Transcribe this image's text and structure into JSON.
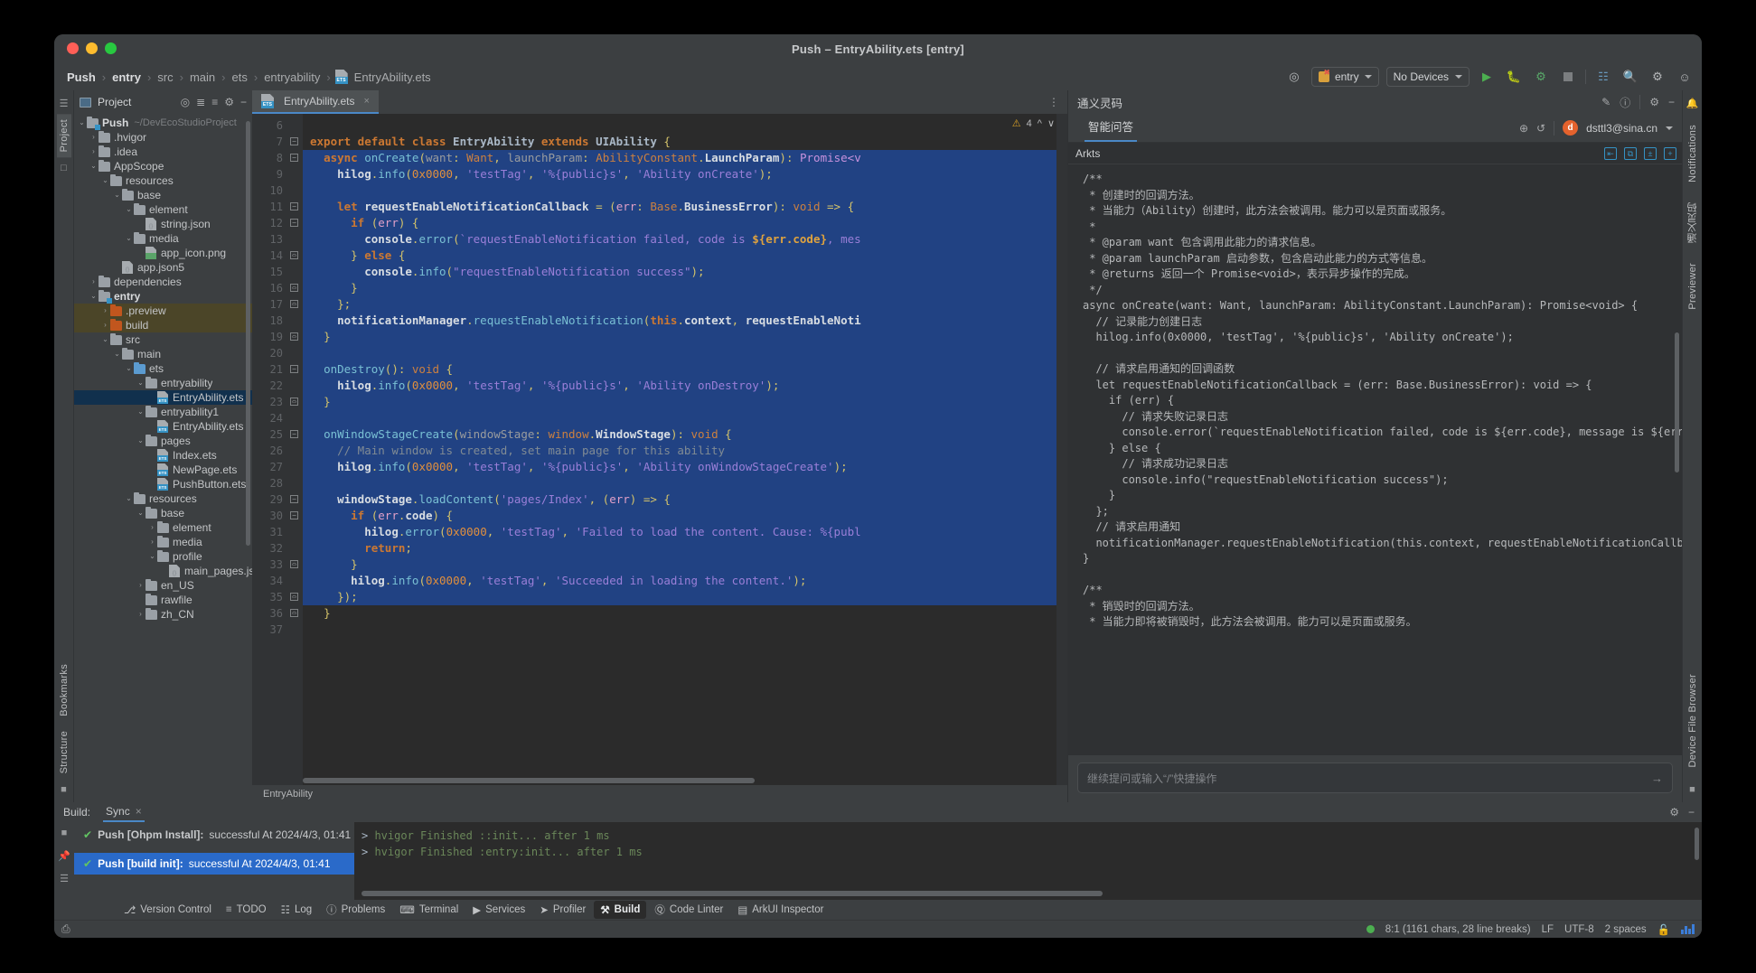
{
  "window": {
    "title": "Push – EntryAbility.ets [entry]",
    "traffic": [
      "close",
      "minimize",
      "zoom"
    ]
  },
  "breadcrumb": {
    "items": [
      "Push",
      "entry",
      "src",
      "main",
      "ets",
      "entryability",
      "EntryAbility.ets"
    ],
    "separator": "›"
  },
  "toolbar": {
    "target_icon": "target-icon",
    "run_config": "entry",
    "device": "No Devices",
    "run": "run-icon",
    "debug": "debug-icon",
    "profile": "attach-debugger-icon",
    "stop": "stop-icon",
    "device_manager": "device-manager-icon",
    "search": "search-icon",
    "settings": "gear-icon",
    "account": "account-icon"
  },
  "left_strip": {
    "tabs": [
      "Project"
    ],
    "bookmarks_label": "Bookmarks",
    "structure_label": "Structure"
  },
  "project": {
    "header_title": "Project",
    "icons": [
      "select-opened-file-icon",
      "expand-all-icon",
      "collapse-all-icon",
      "gear-icon",
      "hide-icon"
    ],
    "tree": [
      {
        "depth": 0,
        "arrow": "⌄",
        "kind": "folder-mod",
        "name": "Push",
        "bold": true,
        "path": "~/DevEcoStudioProject"
      },
      {
        "depth": 1,
        "arrow": "›",
        "kind": "folder",
        "name": ".hvigor"
      },
      {
        "depth": 1,
        "arrow": "›",
        "kind": "folder",
        "name": ".idea"
      },
      {
        "depth": 1,
        "arrow": "⌄",
        "kind": "folder",
        "name": "AppScope"
      },
      {
        "depth": 2,
        "arrow": "⌄",
        "kind": "folder",
        "name": "resources"
      },
      {
        "depth": 3,
        "arrow": "⌄",
        "kind": "folder",
        "name": "base"
      },
      {
        "depth": 4,
        "arrow": "⌄",
        "kind": "folder",
        "name": "element"
      },
      {
        "depth": 5,
        "arrow": "",
        "kind": "file-json",
        "name": "string.json"
      },
      {
        "depth": 4,
        "arrow": "⌄",
        "kind": "folder",
        "name": "media"
      },
      {
        "depth": 5,
        "arrow": "",
        "kind": "file-png",
        "name": "app_icon.png"
      },
      {
        "depth": 3,
        "arrow": "",
        "kind": "file-json",
        "name": "app.json5"
      },
      {
        "depth": 1,
        "arrow": "›",
        "kind": "folder",
        "name": "dependencies"
      },
      {
        "depth": 1,
        "arrow": "⌄",
        "kind": "folder-mod",
        "name": "entry",
        "bold": true
      },
      {
        "depth": 2,
        "arrow": "›",
        "kind": "folder-org",
        "name": ".preview",
        "highlight": true
      },
      {
        "depth": 2,
        "arrow": "›",
        "kind": "folder-org",
        "name": "build",
        "highlight": true
      },
      {
        "depth": 2,
        "arrow": "⌄",
        "kind": "folder",
        "name": "src"
      },
      {
        "depth": 3,
        "arrow": "⌄",
        "kind": "folder",
        "name": "main"
      },
      {
        "depth": 4,
        "arrow": "⌄",
        "kind": "folder-src",
        "name": "ets"
      },
      {
        "depth": 5,
        "arrow": "⌄",
        "kind": "folder",
        "name": "entryability"
      },
      {
        "depth": 6,
        "arrow": "",
        "kind": "file-ets",
        "name": "EntryAbility.ets",
        "selected": true
      },
      {
        "depth": 5,
        "arrow": "⌄",
        "kind": "folder",
        "name": "entryability1"
      },
      {
        "depth": 6,
        "arrow": "",
        "kind": "file-ets",
        "name": "EntryAbility.ets"
      },
      {
        "depth": 5,
        "arrow": "⌄",
        "kind": "folder",
        "name": "pages"
      },
      {
        "depth": 6,
        "arrow": "",
        "kind": "file-ets",
        "name": "Index.ets"
      },
      {
        "depth": 6,
        "arrow": "",
        "kind": "file-ets",
        "name": "NewPage.ets"
      },
      {
        "depth": 6,
        "arrow": "",
        "kind": "file-ets",
        "name": "PushButton.ets"
      },
      {
        "depth": 4,
        "arrow": "⌄",
        "kind": "folder",
        "name": "resources"
      },
      {
        "depth": 5,
        "arrow": "⌄",
        "kind": "folder",
        "name": "base"
      },
      {
        "depth": 6,
        "arrow": "›",
        "kind": "folder",
        "name": "element"
      },
      {
        "depth": 6,
        "arrow": "›",
        "kind": "folder",
        "name": "media"
      },
      {
        "depth": 6,
        "arrow": "⌄",
        "kind": "folder",
        "name": "profile"
      },
      {
        "depth": 7,
        "arrow": "",
        "kind": "file-json",
        "name": "main_pages.json"
      },
      {
        "depth": 5,
        "arrow": "›",
        "kind": "folder",
        "name": "en_US"
      },
      {
        "depth": 5,
        "arrow": "",
        "kind": "folder",
        "name": "rawfile"
      },
      {
        "depth": 5,
        "arrow": "›",
        "kind": "folder",
        "name": "zh_CN"
      }
    ]
  },
  "editor": {
    "tab": {
      "label": "EntryAbility.ets",
      "close": "×"
    },
    "warning_count": "4",
    "breadcrumb_footer": "EntryAbility",
    "first_line": 7,
    "lines": [
      {
        "n": 6,
        "fold": "",
        "sel": false,
        "html": ""
      },
      {
        "n": 7,
        "fold": "-",
        "sel": false,
        "html": "<span class='kw'>export default class</span> <span class='cls'>EntryAbility</span> <span class='kw'>extends</span> <span class='cls'>UIAbility</span> <span class='br'>{</span>"
      },
      {
        "n": 8,
        "fold": "-",
        "sel": true,
        "html": "  <span class='kw'>async</span> <span class='fn'>onCreate</span><span class='br'>(</span><span class='par'>want</span><span class='br'>: </span><span class='typ'>Want</span><span class='br'>, </span><span class='par'>launchParam</span><span class='br'>: </span><span class='typ'>AbilityConstant</span><span class='br'>.</span><span class='typ2'>LaunchParam</span><span class='br'>)</span><span class='br'>: </span><span class='typ3'>Promise&lt;v</span>"
      },
      {
        "n": 9,
        "fold": "",
        "sel": true,
        "html": "    <span class='id'>hilog</span><span class='br'>.</span><span class='mth'>info</span><span class='br'>(</span><span class='num'>0x0000</span><span class='br'>, </span><span class='str'>'testTag'</span><span class='br'>, </span><span class='str'>'%{public}s'</span><span class='br'>, </span><span class='str'>'Ability onCreate'</span><span class='br'>);</span>"
      },
      {
        "n": 10,
        "fold": "",
        "sel": true,
        "html": ""
      },
      {
        "n": 11,
        "fold": "-",
        "sel": true,
        "html": "    <span class='kw'>let</span> <span class='id'>requestEnableNotificationCallback</span> <span class='br'>= (</span><span class='par2'>err</span><span class='br'>: </span><span class='typ'>Base</span><span class='br'>.</span><span class='typ2'>BusinessError</span><span class='br'>): </span><span class='typ4'>void</span> <span class='br'>=&gt; {</span>"
      },
      {
        "n": 12,
        "fold": "-",
        "sel": true,
        "html": "      <span class='kw'>if</span> <span class='br'>(</span><span class='par2'>err</span><span class='br'>) {</span>"
      },
      {
        "n": 13,
        "fold": "",
        "sel": true,
        "html": "        <span class='id'>console</span><span class='br'>.</span><span class='mth'>error</span><span class='br'>(</span><span class='str'>`requestEnableNotification failed, code is </span><span class='tpl'>${err.code}</span><span class='str'>, mes</span>"
      },
      {
        "n": 14,
        "fold": "^",
        "sel": true,
        "html": "      <span class='br'>} </span><span class='kw'>else</span> <span class='br'>{</span>"
      },
      {
        "n": 15,
        "fold": "",
        "sel": true,
        "html": "        <span class='id'>console</span><span class='br'>.</span><span class='mth'>info</span><span class='br'>(</span><span class='str'>\"requestEnableNotification success\"</span><span class='br'>);</span>"
      },
      {
        "n": 16,
        "fold": "^",
        "sel": true,
        "html": "      <span class='br'>}</span>"
      },
      {
        "n": 17,
        "fold": "^",
        "sel": true,
        "html": "    <span class='br'>};</span>"
      },
      {
        "n": 18,
        "fold": "",
        "sel": true,
        "html": "    <span class='id'>notificationManager</span><span class='br'>.</span><span class='mth'>requestEnableNotification</span><span class='br'>(</span><span class='kw2'>this</span><span class='br'>.</span><span class='id'>context</span><span class='br'>, </span><span class='id'>requestEnableNoti</span>"
      },
      {
        "n": 19,
        "fold": "^",
        "sel": true,
        "html": "  <span class='br'>}</span>"
      },
      {
        "n": 20,
        "fold": "",
        "sel": true,
        "html": ""
      },
      {
        "n": 21,
        "fold": "-",
        "sel": true,
        "html": "  <span class='fn'>onDestroy</span><span class='br'>(): </span><span class='typ4'>void</span> <span class='br'>{</span>"
      },
      {
        "n": 22,
        "fold": "",
        "sel": true,
        "html": "    <span class='id'>hilog</span><span class='br'>.</span><span class='mth'>info</span><span class='br'>(</span><span class='num'>0x0000</span><span class='br'>, </span><span class='str'>'testTag'</span><span class='br'>, </span><span class='str'>'%{public}s'</span><span class='br'>, </span><span class='str'>'Ability onDestroy'</span><span class='br'>);</span>"
      },
      {
        "n": 23,
        "fold": "^",
        "sel": true,
        "html": "  <span class='br'>}</span>"
      },
      {
        "n": 24,
        "fold": "",
        "sel": true,
        "html": ""
      },
      {
        "n": 25,
        "fold": "-",
        "sel": true,
        "html": "  <span class='fn'>onWindowStageCreate</span><span class='br'>(</span><span class='par'>windowStage</span><span class='br'>: </span><span class='typ'>window</span><span class='br'>.</span><span class='typ2'>WindowStage</span><span class='br'>): </span><span class='typ4'>void</span> <span class='br'>{</span>"
      },
      {
        "n": 26,
        "fold": "",
        "sel": true,
        "html": "    <span class='cm'>// Main window is created, set main page for this ability</span>"
      },
      {
        "n": 27,
        "fold": "",
        "sel": true,
        "html": "    <span class='id'>hilog</span><span class='br'>.</span><span class='mth'>info</span><span class='br'>(</span><span class='num'>0x0000</span><span class='br'>, </span><span class='str'>'testTag'</span><span class='br'>, </span><span class='str'>'%{public}s'</span><span class='br'>, </span><span class='str'>'Ability onWindowStageCreate'</span><span class='br'>);</span>"
      },
      {
        "n": 28,
        "fold": "",
        "sel": true,
        "html": ""
      },
      {
        "n": 29,
        "fold": "-",
        "sel": true,
        "html": "    <span class='id'>windowStage</span><span class='br'>.</span><span class='mth'>loadContent</span><span class='br'>(</span><span class='str'>'pages/Index'</span><span class='br'>, (</span><span class='par2'>err</span><span class='br'>) =&gt; {</span>"
      },
      {
        "n": 30,
        "fold": "-",
        "sel": true,
        "html": "      <span class='kw'>if</span> <span class='br'>(</span><span class='par2'>err</span><span class='br'>.</span><span class='id'>code</span><span class='br'>) {</span>"
      },
      {
        "n": 31,
        "fold": "",
        "sel": true,
        "html": "        <span class='id'>hilog</span><span class='br'>.</span><span class='mth'>error</span><span class='br'>(</span><span class='num'>0x0000</span><span class='br'>, </span><span class='str'>'testTag'</span><span class='br'>, </span><span class='str'>'Failed to load the content. Cause: %{publ</span>"
      },
      {
        "n": 32,
        "fold": "",
        "sel": true,
        "html": "        <span class='kw'>return</span><span class='br'>;</span>"
      },
      {
        "n": 33,
        "fold": "^",
        "sel": true,
        "html": "      <span class='br'>}</span>"
      },
      {
        "n": 34,
        "fold": "",
        "sel": true,
        "html": "      <span class='id'>hilog</span><span class='br'>.</span><span class='mth'>info</span><span class='br'>(</span><span class='num'>0x0000</span><span class='br'>, </span><span class='str'>'testTag'</span><span class='br'>, </span><span class='str'>'Succeeded in loading the content.'</span><span class='br'>);</span>"
      },
      {
        "n": 35,
        "fold": "^",
        "sel": true,
        "html": "    <span class='br'>});</span>"
      },
      {
        "n": 36,
        "fold": "^",
        "sel": false,
        "html": "  <span class='br'>}</span>"
      },
      {
        "n": 37,
        "fold": "",
        "sel": false,
        "html": ""
      }
    ]
  },
  "ai_panel": {
    "title": "通义灵码",
    "header_icons": [
      "edit-icon",
      "help-icon",
      "gear-icon",
      "hide-icon"
    ],
    "tab": "智能问答",
    "new_chat_icon": "plus-circle-icon",
    "history_icon": "history-icon",
    "account_initial": "d",
    "account_email": "dsttl3@sina.cn",
    "lang_label": "Arkts",
    "lang_icons": [
      "insert-at-cursor-icon",
      "copy-icon",
      "diff-icon",
      "new-file-icon"
    ],
    "content": "/**\n * 创建时的回调方法。\n * 当能力（Ability）创建时，此方法会被调用。能力可以是页面或服务。\n *\n * @param want 包含调用此能力的请求信息。\n * @param launchParam 启动参数，包含启动此能力的方式等信息。\n * @returns 返回一个 Promise<void>，表示异步操作的完成。\n */\nasync onCreate(want: Want, launchParam: AbilityConstant.LaunchParam): Promise<void> {\n  // 记录能力创建日志\n  hilog.info(0x0000, 'testTag', '%{public}s', 'Ability onCreate');\n\n  // 请求启用通知的回调函数\n  let requestEnableNotificationCallback = (err: Base.BusinessError): void => {\n    if (err) {\n      // 请求失败记录日志\n      console.error(`requestEnableNotification failed, code is ${err.code}, message is ${err.message\n    } else {\n      // 请求成功记录日志\n      console.info(\"requestEnableNotification success\");\n    }\n  };\n  // 请求启用通知\n  notificationManager.requestEnableNotification(this.context, requestEnableNotificationCallback);\n}\n\n/**\n * 销毁时的回调方法。\n * 当能力即将被销毁时，此方法会被调用。能力可以是页面或服务。",
    "input_placeholder": "继续提问或输入“/”快捷操作",
    "send_icon": "send-icon"
  },
  "right_strip": {
    "tabs": [
      "Notifications",
      "通义灵码",
      "Previewer",
      "Device File Browser"
    ]
  },
  "build_panel": {
    "label": "Build:",
    "tab": "Sync",
    "close": "×",
    "items": [
      {
        "title": "Push [Ohpm Install]:",
        "rest": " successful At 2024/4/3, 01:41",
        "selected": false
      },
      {
        "title": "Push [build init]:",
        "rest": " successful At 2024/4/3, 01:41",
        "selected": true
      }
    ],
    "log": [
      "> hvigor Finished :entry:init... after 1 ms",
      "> hvigor Finished ::init... after 1 ms"
    ],
    "head_icons": [
      "gear-icon",
      "hide-icon",
      "close-icon"
    ],
    "strip_icons": [
      "run-icon",
      "pin-icon",
      "filter-icon"
    ]
  },
  "tool_tabs": [
    {
      "icon": "branch-icon",
      "label": "Version Control",
      "selected": false
    },
    {
      "icon": "todo-icon",
      "label": "TODO",
      "selected": false
    },
    {
      "icon": "log-icon",
      "label": "Log",
      "selected": false
    },
    {
      "icon": "problems-icon",
      "label": "Problems",
      "selected": false
    },
    {
      "icon": "terminal-icon",
      "label": "Terminal",
      "selected": false
    },
    {
      "icon": "services-icon",
      "label": "Services",
      "selected": false
    },
    {
      "icon": "profiler-icon",
      "label": "Profiler",
      "selected": false
    },
    {
      "icon": "build-icon",
      "label": "Build",
      "selected": true
    },
    {
      "icon": "linter-icon",
      "label": "Code Linter",
      "selected": false
    },
    {
      "icon": "inspector-icon",
      "label": "ArkUI Inspector",
      "selected": false
    }
  ],
  "status_bar": {
    "left_icon": "preview-icon",
    "caret": "8:1 (1161 chars, 28 line breaks)",
    "line_ending": "LF",
    "encoding": "UTF-8",
    "indent": "2 spaces",
    "lock_icon": "unlocked-icon",
    "memory_icon": "memory-indicator"
  }
}
